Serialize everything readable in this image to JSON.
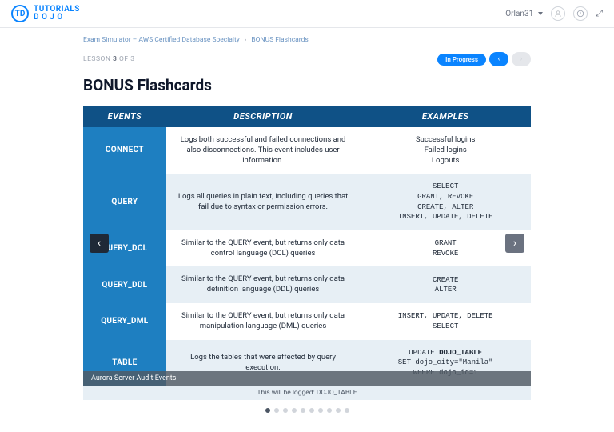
{
  "header": {
    "brand_top": "TUTORIALS",
    "brand_bottom": "D O J O",
    "brand_badge": "TD",
    "username": "Orlan31",
    "expand_glyph": "⤢"
  },
  "breadcrumbs": {
    "a": "Exam Simulator – AWS Certified Database Specialty",
    "b": "BONUS Flashcards"
  },
  "lesson": {
    "label_word": "LESSON",
    "current": "3",
    "of_word": "OF",
    "total": "3",
    "status": "In Progress"
  },
  "page_title": "BONUS Flashcards",
  "table": {
    "headers": {
      "events": "EVENTS",
      "description": "DESCRIPTION",
      "examples": "EXAMPLES"
    },
    "rows": [
      {
        "event": "CONNECT",
        "desc": "Logs both successful and failed connections and also disconnections. This event includes user information.",
        "ex_plain": "Successful logins\nFailed logins\nLogouts"
      },
      {
        "event": "QUERY",
        "desc": "Logs all queries in plain text, including queries that fail due to syntax or permission errors.",
        "ex_mono": "SELECT\nGRANT, REVOKE\nCREATE, ALTER\nINSERT, UPDATE, DELETE"
      },
      {
        "event": "QUERY_DCL",
        "desc": "Similar to the QUERY event, but returns only data control language (DCL) queries",
        "ex_mono": "GRANT\nREVOKE"
      },
      {
        "event": "QUERY_DDL",
        "desc": "Similar to the QUERY event, but returns only data definition language (DDL) queries",
        "ex_mono": "CREATE\nALTER"
      },
      {
        "event": "QUERY_DML",
        "desc": "Similar to the QUERY event, but returns only data manipulation language (DML) queries",
        "ex_mono": "INSERT, UPDATE, DELETE\nSELECT"
      },
      {
        "event": "TABLE",
        "desc": "Logs the tables that were affected by query execution.",
        "ex_mono_html": "UPDATE <b>DOJO_TABLE</b>\nSET dojo_city=\"Manila\"\nWHERE dojo_id=1"
      }
    ],
    "footnote": "This will be logged: DOJO_TABLE"
  },
  "caption": "Aurora Server Audit Events",
  "dots": {
    "count": 10,
    "active": 0
  }
}
